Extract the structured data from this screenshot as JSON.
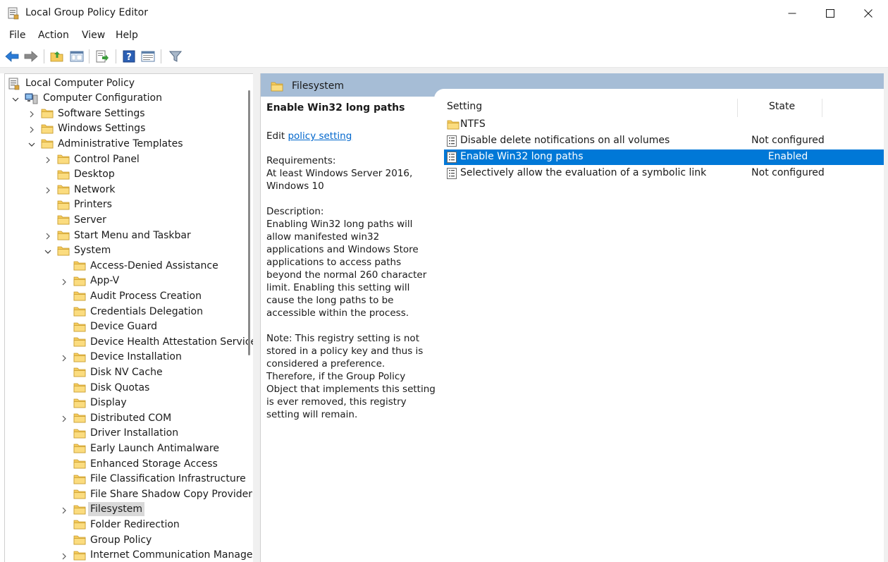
{
  "window": {
    "title": "Local Group Policy Editor",
    "minimize_glyph": "—",
    "maximize_glyph": "☐",
    "close_glyph": "✕"
  },
  "menu": [
    "File",
    "Action",
    "View",
    "Help"
  ],
  "toolbar_icons": [
    "back-arrow-icon",
    "forward-arrow-icon",
    "up-folder-icon",
    "show-hide-tree-icon",
    "export-list-icon",
    "help-icon",
    "properties-icon",
    "filter-icon"
  ],
  "tree": [
    {
      "label": "Local Computer Policy",
      "indent": 0,
      "expander": "none",
      "icon": "policy-doc-icon"
    },
    {
      "label": "Computer Configuration",
      "indent": 1,
      "expander": "expanded",
      "icon": "computer-icon"
    },
    {
      "label": "Software Settings",
      "indent": 2,
      "expander": "collapsed",
      "icon": "folder-icon"
    },
    {
      "label": "Windows Settings",
      "indent": 2,
      "expander": "collapsed",
      "icon": "folder-icon"
    },
    {
      "label": "Administrative Templates",
      "indent": 2,
      "expander": "expanded",
      "icon": "folder-icon"
    },
    {
      "label": "Control Panel",
      "indent": 3,
      "expander": "collapsed",
      "icon": "folder-icon"
    },
    {
      "label": "Desktop",
      "indent": 3,
      "expander": "none",
      "icon": "folder-icon"
    },
    {
      "label": "Network",
      "indent": 3,
      "expander": "collapsed",
      "icon": "folder-icon"
    },
    {
      "label": "Printers",
      "indent": 3,
      "expander": "none",
      "icon": "folder-icon"
    },
    {
      "label": "Server",
      "indent": 3,
      "expander": "none",
      "icon": "folder-icon"
    },
    {
      "label": "Start Menu and Taskbar",
      "indent": 3,
      "expander": "collapsed",
      "icon": "folder-icon"
    },
    {
      "label": "System",
      "indent": 3,
      "expander": "expanded",
      "icon": "folder-icon"
    },
    {
      "label": "Access-Denied Assistance",
      "indent": 4,
      "expander": "none",
      "icon": "folder-icon"
    },
    {
      "label": "App-V",
      "indent": 4,
      "expander": "collapsed",
      "icon": "folder-icon"
    },
    {
      "label": "Audit Process Creation",
      "indent": 4,
      "expander": "none",
      "icon": "folder-icon"
    },
    {
      "label": "Credentials Delegation",
      "indent": 4,
      "expander": "none",
      "icon": "folder-icon"
    },
    {
      "label": "Device Guard",
      "indent": 4,
      "expander": "none",
      "icon": "folder-icon"
    },
    {
      "label": "Device Health Attestation Service",
      "indent": 4,
      "expander": "none",
      "icon": "folder-icon"
    },
    {
      "label": "Device Installation",
      "indent": 4,
      "expander": "collapsed",
      "icon": "folder-icon"
    },
    {
      "label": "Disk NV Cache",
      "indent": 4,
      "expander": "none",
      "icon": "folder-icon"
    },
    {
      "label": "Disk Quotas",
      "indent": 4,
      "expander": "none",
      "icon": "folder-icon"
    },
    {
      "label": "Display",
      "indent": 4,
      "expander": "none",
      "icon": "folder-icon"
    },
    {
      "label": "Distributed COM",
      "indent": 4,
      "expander": "collapsed",
      "icon": "folder-icon"
    },
    {
      "label": "Driver Installation",
      "indent": 4,
      "expander": "none",
      "icon": "folder-icon"
    },
    {
      "label": "Early Launch Antimalware",
      "indent": 4,
      "expander": "none",
      "icon": "folder-icon"
    },
    {
      "label": "Enhanced Storage Access",
      "indent": 4,
      "expander": "none",
      "icon": "folder-icon"
    },
    {
      "label": "File Classification Infrastructure",
      "indent": 4,
      "expander": "none",
      "icon": "folder-icon"
    },
    {
      "label": "File Share Shadow Copy Provider",
      "indent": 4,
      "expander": "none",
      "icon": "folder-icon"
    },
    {
      "label": "Filesystem",
      "indent": 4,
      "expander": "collapsed",
      "icon": "folder-icon",
      "selected": true
    },
    {
      "label": "Folder Redirection",
      "indent": 4,
      "expander": "none",
      "icon": "folder-icon"
    },
    {
      "label": "Group Policy",
      "indent": 4,
      "expander": "none",
      "icon": "folder-icon"
    },
    {
      "label": "Internet Communication Managem",
      "indent": 4,
      "expander": "collapsed",
      "icon": "folder-icon"
    }
  ],
  "right_pane": {
    "header_title": "Filesystem",
    "description": {
      "title": "Enable Win32 long paths",
      "edit_prefix": "Edit ",
      "edit_link": "policy setting ",
      "requirements_label": "Requirements:",
      "requirements_text": "At least Windows Server 2016, Windows 10",
      "description_label": "Description:",
      "description_text": "Enabling Win32 long paths will allow manifested win32 applications and Windows Store applications to access paths beyond the normal 260 character limit.  Enabling this setting will cause the long paths to be accessible within the process.",
      "note_text": "Note:  This registry setting is not stored in a policy key and thus is considered a preference.  Therefore, if the Group Policy Object that implements this setting is ever removed, this registry setting will remain."
    },
    "columns": {
      "setting": "Setting",
      "state": "State"
    },
    "rows": [
      {
        "name": "NTFS",
        "state": "",
        "icon": "folder-icon",
        "selected": false
      },
      {
        "name": "Disable delete notifications on all volumes",
        "state": "Not configured",
        "icon": "setting-icon",
        "selected": false
      },
      {
        "name": "Enable Win32 long paths",
        "state": "Enabled",
        "icon": "setting-icon",
        "selected": true
      },
      {
        "name": "Selectively allow the evaluation of a symbolic link",
        "state": "Not configured",
        "icon": "setting-icon",
        "selected": false
      }
    ]
  },
  "colors": {
    "header_band": "#a6bdd6",
    "selection": "#0078d7",
    "link": "#0066cc",
    "folder": "#f5cb5c"
  }
}
